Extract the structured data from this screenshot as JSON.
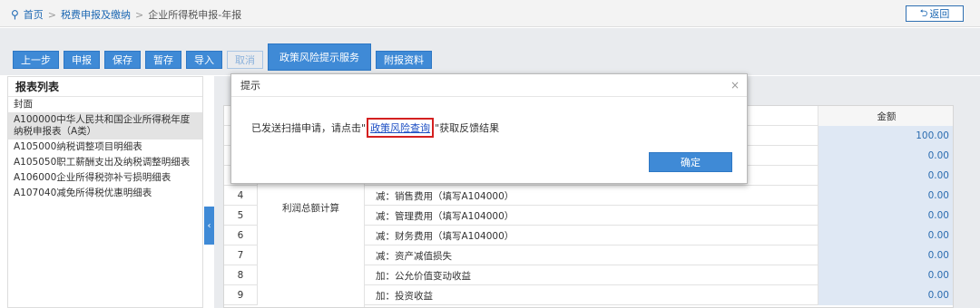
{
  "breadcrumb": {
    "home": "首页",
    "level1": "税费申报及缴纳",
    "current": "企业所得税申报-年报",
    "separator": ">"
  },
  "back_button": "返回",
  "toolbar": {
    "prev": "上一步",
    "declare": "申报",
    "save": "保存",
    "temp_save": "暂存",
    "import": "导入",
    "cancel": "取消",
    "policy_risk": "政策风险提示服务",
    "attachments": "附报资料"
  },
  "left_panel": {
    "title": "报表列表",
    "items": [
      "封面",
      "A100000中华人民共和国企业所得税年度纳税申报表（A类）",
      "A105000纳税调整项目明细表",
      "A105050职工薪酬支出及纳税调整明细表",
      "A106000企业所得税弥补亏损明细表",
      "A107040减免所得税优惠明细表"
    ],
    "active_index": 1
  },
  "table": {
    "amount_header": "金额",
    "category": "利润总额计算",
    "rows": [
      {
        "idx": "",
        "item": "",
        "value": "100.00"
      },
      {
        "idx": "",
        "item": "",
        "value": "0.00"
      },
      {
        "idx": "",
        "item": "",
        "value": "0.00"
      },
      {
        "idx": "4",
        "item": "减：销售费用（填写A104000）",
        "value": "0.00"
      },
      {
        "idx": "5",
        "item": "减：管理费用（填写A104000）",
        "value": "0.00"
      },
      {
        "idx": "6",
        "item": "减：财务费用（填写A104000）",
        "value": "0.00"
      },
      {
        "idx": "7",
        "item": "减：资产减值损失",
        "value": "0.00"
      },
      {
        "idx": "8",
        "item": "加：公允价值变动收益",
        "value": "0.00"
      },
      {
        "idx": "9",
        "item": "加：投资收益",
        "value": "0.00"
      }
    ]
  },
  "modal": {
    "title": "提示",
    "close": "×",
    "message_before": "已发送扫描申请，请点击",
    "quote_open": "\"",
    "link": "政策风险查询",
    "quote_close": "\"",
    "message_after": "获取反馈结果",
    "confirm": "确定"
  },
  "icons": {
    "home": "location-pin-icon",
    "back": "return-arrow-icon",
    "collapse": "chevron-left-icon"
  },
  "colors": {
    "primary": "#3f8ad6",
    "link": "#1d68b3",
    "highlight_border": "#d42020",
    "value_cell": "#dfe8f4"
  }
}
